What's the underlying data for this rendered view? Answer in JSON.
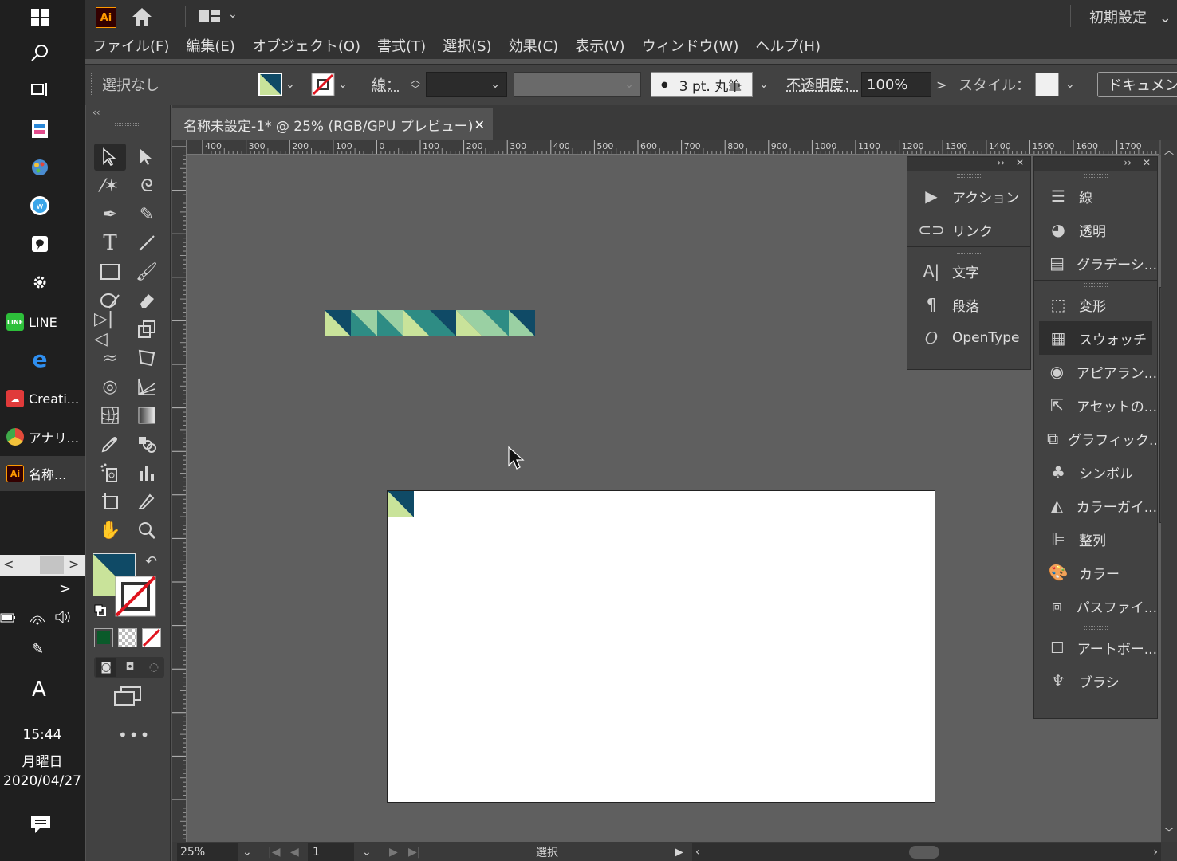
{
  "taskbar": {
    "apps": [
      {
        "label": "LINE"
      },
      {
        "label": "Creati..."
      },
      {
        "label": "アナリ..."
      },
      {
        "label": "名称..."
      }
    ],
    "time": "15:44",
    "weekday": "月曜日",
    "date": "2020/04/27"
  },
  "app": {
    "logo": "Ai",
    "workspace": "初期設定"
  },
  "menu": [
    "ファイル(F)",
    "編集(E)",
    "オブジェクト(O)",
    "書式(T)",
    "選択(S)",
    "効果(C)",
    "表示(V)",
    "ウィンドウ(W)",
    "ヘルプ(H)"
  ],
  "control": {
    "selection": "選択なし",
    "stroke_label": "線：",
    "brush": "3 pt. 丸筆",
    "opacity_label": "不透明度：",
    "opacity": "100%",
    "style_label": "スタイル：",
    "document_btn": "ドキュメン"
  },
  "document": {
    "tab_title": "名称未設定-1* @ 25% (RGB/GPU プレビュー)",
    "zoom": "25%",
    "artboard": "1",
    "status": "選択"
  },
  "ruler": {
    "h_ticks": [
      "400",
      "300",
      "200",
      "100",
      "0",
      "100",
      "200",
      "300",
      "400",
      "500",
      "600",
      "700",
      "800",
      "900",
      "1000",
      "1100",
      "1200",
      "1300",
      "1400",
      "1500",
      "1600",
      "1700"
    ]
  },
  "panels": {
    "left_group_a": [
      "アクション",
      "リンク"
    ],
    "left_group_b": [
      "文字",
      "段落",
      "OpenType"
    ],
    "right_group_a": [
      "線",
      "透明",
      "グラデーシ..."
    ],
    "right_group_b": [
      "変形",
      "スウォッチ",
      "アピアラン...",
      "アセットの...",
      "グラフィック...",
      "シンボル",
      "カラーガイ...",
      "整列",
      "カラー",
      "パスファイ..."
    ],
    "right_group_c": [
      "アートボー...",
      "ブラシ"
    ]
  },
  "colors": {
    "navy": "#0f4a66",
    "teal": "#2e8c84",
    "mint": "#9ad0a3",
    "lime": "#c9e39a"
  }
}
